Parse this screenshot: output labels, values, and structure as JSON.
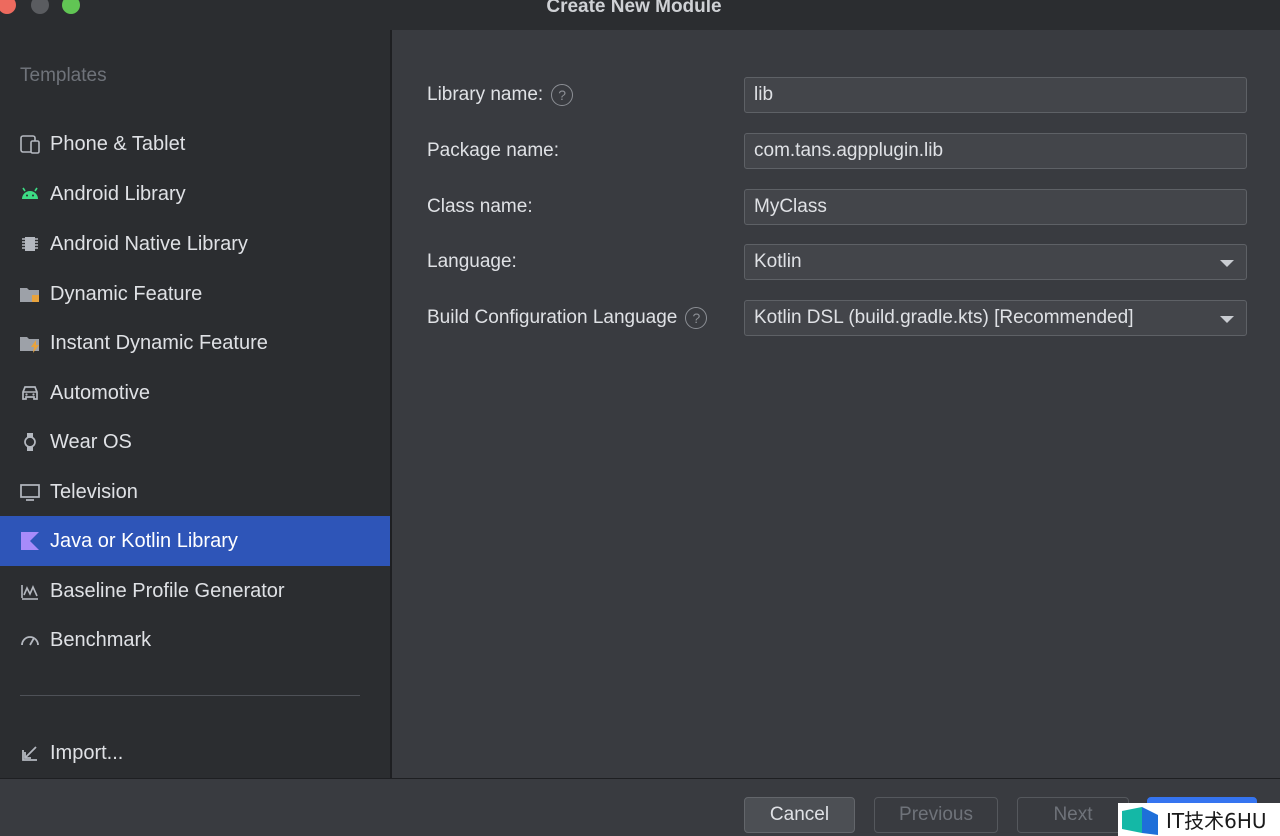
{
  "window": {
    "title": "Create New Module"
  },
  "sidebar": {
    "heading": "Templates",
    "items": [
      {
        "label": "Phone & Tablet",
        "icon": "phone-tablet-icon"
      },
      {
        "label": "Android Library",
        "icon": "android-icon"
      },
      {
        "label": "Android Native Library",
        "icon": "chip-icon"
      },
      {
        "label": "Dynamic Feature",
        "icon": "folder-module-icon"
      },
      {
        "label": "Instant Dynamic Feature",
        "icon": "folder-lightning-icon"
      },
      {
        "label": "Automotive",
        "icon": "car-icon"
      },
      {
        "label": "Wear OS",
        "icon": "watch-icon"
      },
      {
        "label": "Television",
        "icon": "tv-icon"
      },
      {
        "label": "Java or Kotlin Library",
        "icon": "kotlin-icon",
        "selected": true
      },
      {
        "label": "Baseline Profile Generator",
        "icon": "baseline-profile-icon"
      },
      {
        "label": "Benchmark",
        "icon": "gauge-icon"
      }
    ],
    "import_label": "Import..."
  },
  "form": {
    "library_name": {
      "label": "Library name:",
      "value": "lib",
      "help": "?"
    },
    "package_name": {
      "label": "Package name:",
      "value": "com.tans.agpplugin.lib"
    },
    "class_name": {
      "label": "Class name:",
      "value": "MyClass"
    },
    "language": {
      "label": "Language:",
      "value": "Kotlin"
    },
    "build_config_language": {
      "label": "Build Configuration Language",
      "value": "Kotlin DSL (build.gradle.kts) [Recommended]",
      "help": "?"
    }
  },
  "footer": {
    "cancel": "Cancel",
    "previous": "Previous",
    "next": "Next"
  },
  "watermark": {
    "text": "IT技术6HU"
  },
  "colors": {
    "selection": "#2e55b8",
    "accent": "#3574f0",
    "android_green": "#3ddc84",
    "kotlin_purple": "#7f52ff"
  }
}
